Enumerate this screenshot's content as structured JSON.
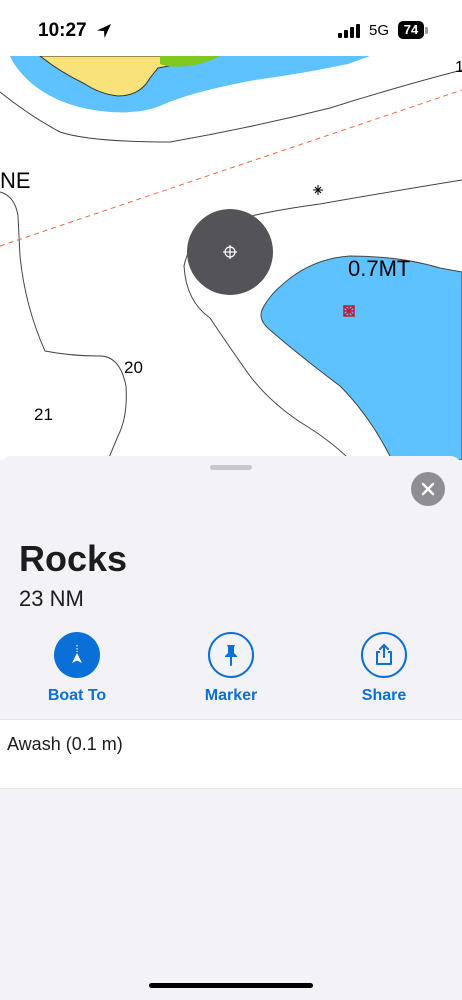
{
  "status_bar": {
    "time": "10:27",
    "network": "5G",
    "battery": "74"
  },
  "map": {
    "labels": {
      "name_fragment": "NE",
      "depth_1": "20",
      "depth_2": "21",
      "edge_digit": "1",
      "feature_depth": "0.7MT"
    },
    "colors": {
      "water": "#5ec2ff",
      "land": "#f9e27a",
      "green": "#7ec820",
      "route": "#f06a3a",
      "selection": "#545458"
    }
  },
  "sheet": {
    "title": "Rocks",
    "distance": "23 NM",
    "actions": [
      {
        "label": "Boat To",
        "icon": "boat-to-icon"
      },
      {
        "label": "Marker",
        "icon": "pin-icon"
      },
      {
        "label": "Share",
        "icon": "share-icon"
      }
    ],
    "detail": "Awash (0.1 m)",
    "accent_color": "#0a6fd6"
  }
}
